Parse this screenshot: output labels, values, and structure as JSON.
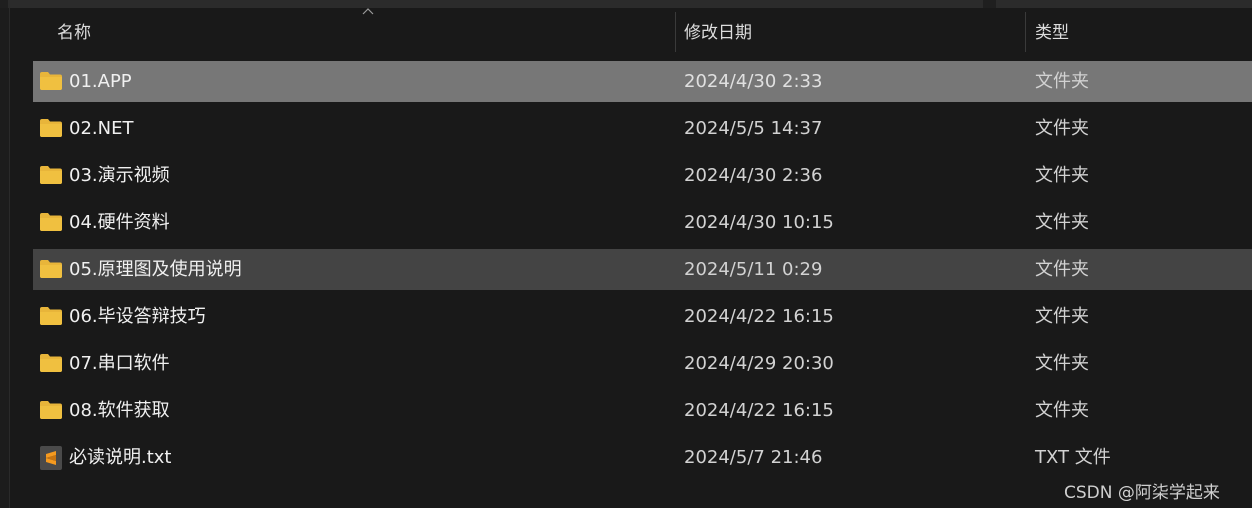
{
  "columns": {
    "name": "名称",
    "date": "修改日期",
    "type": "类型"
  },
  "rows": [
    {
      "name": "01.APP",
      "date": "2024/4/30 2:33",
      "type": "文件夹",
      "icon": "folder-icon",
      "state": "selected"
    },
    {
      "name": "02.NET",
      "date": "2024/5/5 14:37",
      "type": "文件夹",
      "icon": "folder-icon",
      "state": ""
    },
    {
      "name": "03.演示视频",
      "date": "2024/4/30 2:36",
      "type": "文件夹",
      "icon": "folder-icon",
      "state": ""
    },
    {
      "name": "04.硬件资料",
      "date": "2024/4/30 10:15",
      "type": "文件夹",
      "icon": "folder-icon",
      "state": ""
    },
    {
      "name": "05.原理图及使用说明",
      "date": "2024/5/11 0:29",
      "type": "文件夹",
      "icon": "folder-icon",
      "state": "hover"
    },
    {
      "name": "06.毕设答辩技巧",
      "date": "2024/4/22 16:15",
      "type": "文件夹",
      "icon": "folder-icon",
      "state": ""
    },
    {
      "name": "07.串口软件",
      "date": "2024/4/29 20:30",
      "type": "文件夹",
      "icon": "folder-icon",
      "state": ""
    },
    {
      "name": "08.软件获取",
      "date": "2024/4/22 16:15",
      "type": "文件夹",
      "icon": "folder-icon",
      "state": ""
    },
    {
      "name": "必读说明.txt",
      "date": "2024/5/7 21:46",
      "type": "TXT 文件",
      "icon": "sublime-text-file-icon",
      "state": ""
    }
  ],
  "watermark": "CSDN @阿柒学起来",
  "colors": {
    "background": "#191919",
    "selected_row": "#777777",
    "hover_row": "#444444",
    "folder": "#f0c040",
    "sublime": "#f59a1f"
  }
}
